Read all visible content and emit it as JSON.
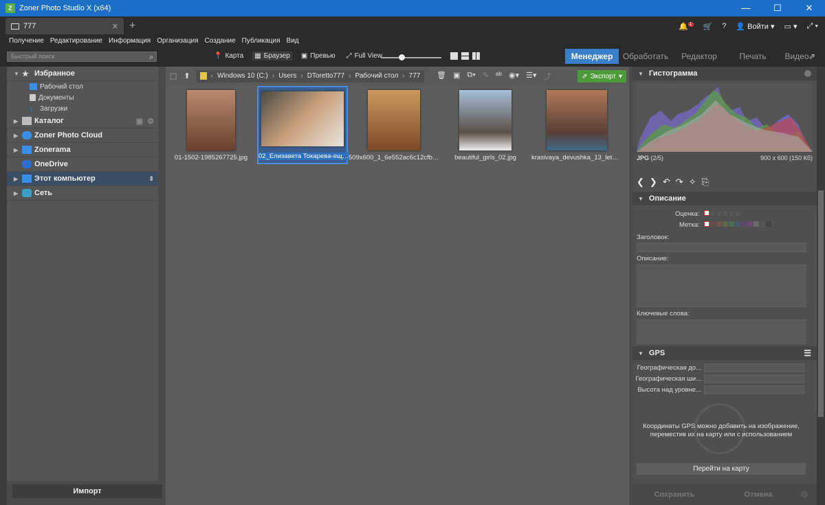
{
  "window": {
    "title": "Zoner Photo Studio X (x64)",
    "minimize": "—",
    "maximize": "☐",
    "close": "✕"
  },
  "tab": {
    "label": "777",
    "close": "✕",
    "new_tab": "+"
  },
  "topright": {
    "notifications_badge": "1",
    "help": "?",
    "login": "Войти"
  },
  "menu": [
    "Получение",
    "Редактирование",
    "Информация",
    "Организация",
    "Создание",
    "Публикация",
    "Вид"
  ],
  "search": {
    "placeholder": "Быстрый поиск"
  },
  "views": {
    "map": "Карта",
    "browser": "Браузер",
    "preview": "Превью",
    "fullview": "Full View"
  },
  "modes": {
    "manager": "Менеджер",
    "process": "Обработать",
    "editor": "Редактор",
    "print": "Печать",
    "video": "Видео"
  },
  "sidebar": {
    "favorites": "Избранное",
    "fav_items": [
      "Рабочий стол",
      "Документы",
      "Загрузки"
    ],
    "catalog": "Каталог",
    "cloud": "Zoner Photo Cloud",
    "zonerama": "Zonerama",
    "onedrive": "OneDrive",
    "computer": "Этот компьютер",
    "network": "Сеть",
    "import": "Импорт"
  },
  "path": {
    "crumbs": [
      "Windows 10 (C:)",
      "Users",
      "DToretto777",
      "Рабочий стол",
      "777"
    ],
    "export": "Экспорт"
  },
  "files": [
    {
      "name": "01-1502-1985267725.jpg",
      "color": "#8a5a44"
    },
    {
      "name": "02_Елизавета Токарева-еще...",
      "color": "#9c7a5a",
      "selected": true
    },
    {
      "name": "509x600_1_6e552ac6c12cfbb...",
      "color": "#a0703e"
    },
    {
      "name": "beautiful_girls_02.jpg",
      "color": "#6a7d8a"
    },
    {
      "name": "krasivaya_devushka_13_let_2...",
      "color": "#a86a4a"
    }
  ],
  "histogram": {
    "title": "Гистограмма",
    "format": "JPG",
    "index": "(2/5)",
    "info": "900 x 600 (150 Кб)"
  },
  "description": {
    "title": "Описание",
    "rating": "Оценка:",
    "label": "Метка:",
    "header": "Заголовок:",
    "desc": "Описание:",
    "keywords": "Ключевые слова:"
  },
  "gps": {
    "title": "GPS",
    "lat": "Географическая до...",
    "lon": "Географическая ши...",
    "alt": "Высота над уровне...",
    "hint1": "Координаты GPS можно добавить на изображение,",
    "hint2": "переместив их на карту или с использованием",
    "goto_map": "Перейти на карту"
  },
  "actions": {
    "save": "Сохранить",
    "cancel": "Отмена"
  }
}
